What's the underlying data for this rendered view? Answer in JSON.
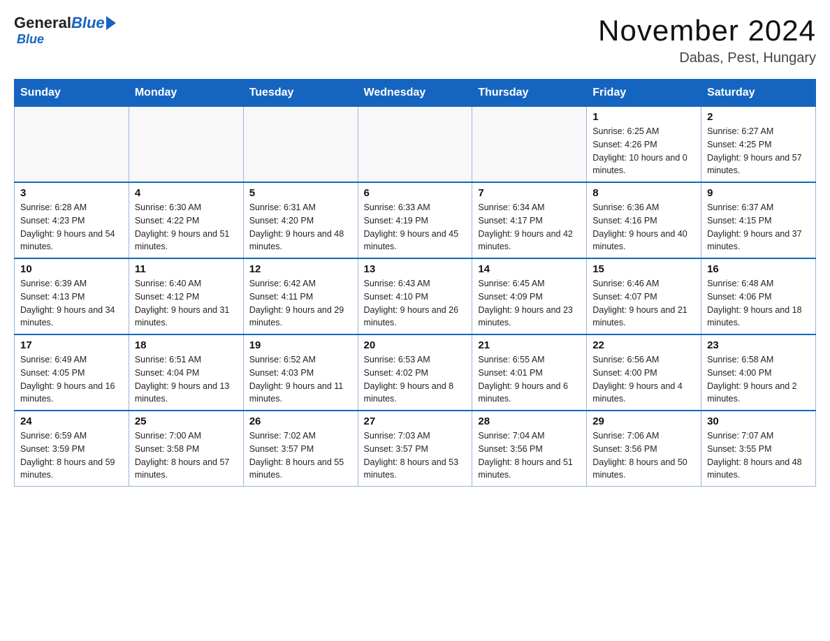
{
  "header": {
    "logo_general": "General",
    "logo_blue": "Blue",
    "month_title": "November 2024",
    "location": "Dabas, Pest, Hungary"
  },
  "days_of_week": [
    "Sunday",
    "Monday",
    "Tuesday",
    "Wednesday",
    "Thursday",
    "Friday",
    "Saturday"
  ],
  "weeks": [
    [
      {
        "num": "",
        "info": ""
      },
      {
        "num": "",
        "info": ""
      },
      {
        "num": "",
        "info": ""
      },
      {
        "num": "",
        "info": ""
      },
      {
        "num": "",
        "info": ""
      },
      {
        "num": "1",
        "info": "Sunrise: 6:25 AM\nSunset: 4:26 PM\nDaylight: 10 hours and 0 minutes."
      },
      {
        "num": "2",
        "info": "Sunrise: 6:27 AM\nSunset: 4:25 PM\nDaylight: 9 hours and 57 minutes."
      }
    ],
    [
      {
        "num": "3",
        "info": "Sunrise: 6:28 AM\nSunset: 4:23 PM\nDaylight: 9 hours and 54 minutes."
      },
      {
        "num": "4",
        "info": "Sunrise: 6:30 AM\nSunset: 4:22 PM\nDaylight: 9 hours and 51 minutes."
      },
      {
        "num": "5",
        "info": "Sunrise: 6:31 AM\nSunset: 4:20 PM\nDaylight: 9 hours and 48 minutes."
      },
      {
        "num": "6",
        "info": "Sunrise: 6:33 AM\nSunset: 4:19 PM\nDaylight: 9 hours and 45 minutes."
      },
      {
        "num": "7",
        "info": "Sunrise: 6:34 AM\nSunset: 4:17 PM\nDaylight: 9 hours and 42 minutes."
      },
      {
        "num": "8",
        "info": "Sunrise: 6:36 AM\nSunset: 4:16 PM\nDaylight: 9 hours and 40 minutes."
      },
      {
        "num": "9",
        "info": "Sunrise: 6:37 AM\nSunset: 4:15 PM\nDaylight: 9 hours and 37 minutes."
      }
    ],
    [
      {
        "num": "10",
        "info": "Sunrise: 6:39 AM\nSunset: 4:13 PM\nDaylight: 9 hours and 34 minutes."
      },
      {
        "num": "11",
        "info": "Sunrise: 6:40 AM\nSunset: 4:12 PM\nDaylight: 9 hours and 31 minutes."
      },
      {
        "num": "12",
        "info": "Sunrise: 6:42 AM\nSunset: 4:11 PM\nDaylight: 9 hours and 29 minutes."
      },
      {
        "num": "13",
        "info": "Sunrise: 6:43 AM\nSunset: 4:10 PM\nDaylight: 9 hours and 26 minutes."
      },
      {
        "num": "14",
        "info": "Sunrise: 6:45 AM\nSunset: 4:09 PM\nDaylight: 9 hours and 23 minutes."
      },
      {
        "num": "15",
        "info": "Sunrise: 6:46 AM\nSunset: 4:07 PM\nDaylight: 9 hours and 21 minutes."
      },
      {
        "num": "16",
        "info": "Sunrise: 6:48 AM\nSunset: 4:06 PM\nDaylight: 9 hours and 18 minutes."
      }
    ],
    [
      {
        "num": "17",
        "info": "Sunrise: 6:49 AM\nSunset: 4:05 PM\nDaylight: 9 hours and 16 minutes."
      },
      {
        "num": "18",
        "info": "Sunrise: 6:51 AM\nSunset: 4:04 PM\nDaylight: 9 hours and 13 minutes."
      },
      {
        "num": "19",
        "info": "Sunrise: 6:52 AM\nSunset: 4:03 PM\nDaylight: 9 hours and 11 minutes."
      },
      {
        "num": "20",
        "info": "Sunrise: 6:53 AM\nSunset: 4:02 PM\nDaylight: 9 hours and 8 minutes."
      },
      {
        "num": "21",
        "info": "Sunrise: 6:55 AM\nSunset: 4:01 PM\nDaylight: 9 hours and 6 minutes."
      },
      {
        "num": "22",
        "info": "Sunrise: 6:56 AM\nSunset: 4:00 PM\nDaylight: 9 hours and 4 minutes."
      },
      {
        "num": "23",
        "info": "Sunrise: 6:58 AM\nSunset: 4:00 PM\nDaylight: 9 hours and 2 minutes."
      }
    ],
    [
      {
        "num": "24",
        "info": "Sunrise: 6:59 AM\nSunset: 3:59 PM\nDaylight: 8 hours and 59 minutes."
      },
      {
        "num": "25",
        "info": "Sunrise: 7:00 AM\nSunset: 3:58 PM\nDaylight: 8 hours and 57 minutes."
      },
      {
        "num": "26",
        "info": "Sunrise: 7:02 AM\nSunset: 3:57 PM\nDaylight: 8 hours and 55 minutes."
      },
      {
        "num": "27",
        "info": "Sunrise: 7:03 AM\nSunset: 3:57 PM\nDaylight: 8 hours and 53 minutes."
      },
      {
        "num": "28",
        "info": "Sunrise: 7:04 AM\nSunset: 3:56 PM\nDaylight: 8 hours and 51 minutes."
      },
      {
        "num": "29",
        "info": "Sunrise: 7:06 AM\nSunset: 3:56 PM\nDaylight: 8 hours and 50 minutes."
      },
      {
        "num": "30",
        "info": "Sunrise: 7:07 AM\nSunset: 3:55 PM\nDaylight: 8 hours and 48 minutes."
      }
    ]
  ]
}
